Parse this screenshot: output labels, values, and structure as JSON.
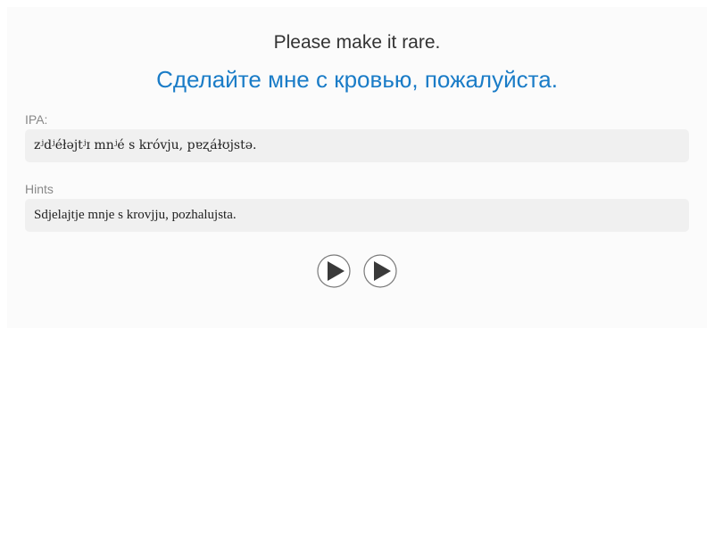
{
  "phrase": {
    "english": "Please make it rare.",
    "russian": "Сделайте мне с кровью, пожалуйста."
  },
  "ipa": {
    "label": "IPA:",
    "value": "zʲdʲéłəjtʲɪ mnʲé s króvju, pɐʐáɫʊjstə."
  },
  "hints": {
    "label": "Hints",
    "value": "Sdjelajtje mnje s krovjju, pozhalujsta."
  },
  "audio": {
    "buttons": [
      {
        "icon": "play-icon"
      },
      {
        "icon": "play-icon"
      }
    ]
  },
  "colors": {
    "accent": "#1a7cc7",
    "text": "#333333",
    "label": "#888888",
    "field_bg": "#f0f0f0",
    "card_bg": "#fbfbfb"
  }
}
